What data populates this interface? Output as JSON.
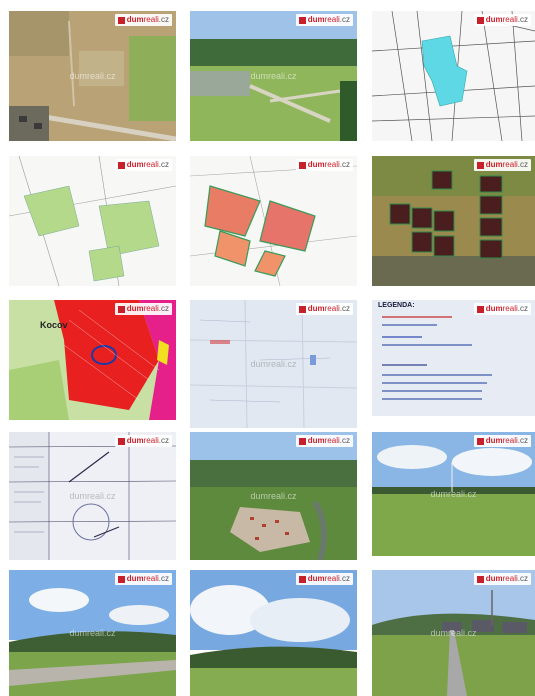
{
  "gallery": {
    "logo": {
      "part1": "dum",
      "part2": "reali",
      "part3": ".cz"
    },
    "watermark": "dumreali.cz",
    "map_place_name": "Kocov",
    "legend_title": "LEGENDA:",
    "photos": [
      {
        "name": "aerial-plots-top"
      },
      {
        "name": "aerial-village-road"
      },
      {
        "name": "cadastral-map-cyan"
      },
      {
        "name": "plot-plan-green"
      },
      {
        "name": "plot-plan-red"
      },
      {
        "name": "aerial-plots-numbered"
      },
      {
        "name": "zoning-map-red"
      },
      {
        "name": "paper-map"
      },
      {
        "name": "document-legend"
      },
      {
        "name": "document-stamp"
      },
      {
        "name": "aerial-river-village"
      },
      {
        "name": "meadow-landscape"
      },
      {
        "name": "road-hills-landscape"
      },
      {
        "name": "cloudy-meadow"
      },
      {
        "name": "country-road-houses"
      }
    ]
  }
}
